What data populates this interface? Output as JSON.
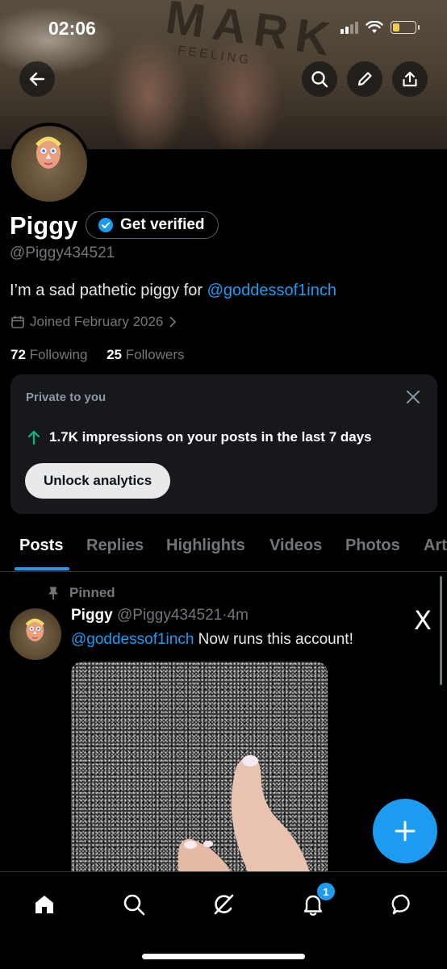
{
  "status_bar": {
    "time": "02:06"
  },
  "banner": {
    "text": "MARK",
    "subtext": "FEELING"
  },
  "header": {
    "back_icon": "arrow-left-icon",
    "search_icon": "search-icon",
    "edit_icon": "pencil-icon",
    "share_icon": "share-icon"
  },
  "profile": {
    "name": "Piggy",
    "get_verified_label": "Get verified",
    "handle": "@Piggy434521",
    "bio_text": "I’m a sad pathetic piggy for ",
    "bio_mention": "@goddessof1inch",
    "joined": "Joined February 2026",
    "following_count": "72",
    "following_label": "Following",
    "followers_count": "25",
    "followers_label": "Followers"
  },
  "analytics_card": {
    "title": "Private to you",
    "stat": "1.7K impressions on your posts in the last 7 days",
    "button": "Unlock analytics"
  },
  "tabs": [
    {
      "label": "Posts",
      "active": true
    },
    {
      "label": "Replies"
    },
    {
      "label": "Highlights"
    },
    {
      "label": "Videos"
    },
    {
      "label": "Photos"
    },
    {
      "label": "Art"
    }
  ],
  "post": {
    "pinned_label": "Pinned",
    "author_name": "Piggy",
    "author_handle": "@Piggy434521",
    "separator": "·",
    "time": "4m",
    "mention": "@goddessof1inch",
    "text": " Now runs this account!",
    "platform_mark": "X"
  },
  "bottom_nav": {
    "items": [
      "home-icon",
      "search-icon",
      "grok-icon",
      "notifications-icon",
      "messages-icon"
    ],
    "notification_badge": "1"
  },
  "colors": {
    "accent": "#1d9bf0",
    "background": "#000000",
    "secondary_text": "#71767b",
    "card_background": "#16181c"
  }
}
